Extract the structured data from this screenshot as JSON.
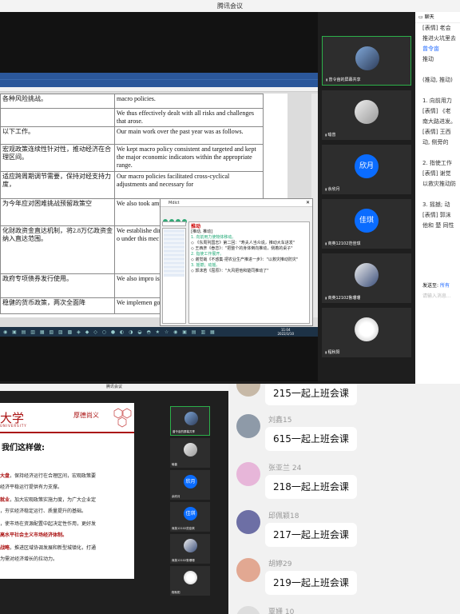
{
  "top_window": {
    "title": "腾讯会议",
    "doc_rows": [
      {
        "zh": "各种风险挑战。",
        "en": "macro policies."
      },
      {
        "zh": "",
        "en": "We thus effectively dealt with all risks and challenges that arose."
      },
      {
        "zh": "以下工作。",
        "en": "Our main work over the past year was as follows."
      },
      {
        "zh": "宏观政策连续性针对性，推动经济在合理区间。",
        "en": "We kept macro policy consistent and targeted and kept the major economic indicators within the appropriate range."
      },
      {
        "zh": "适应跨周期调节需要，保持对经支持力度，",
        "en": "Our macro policies facilitated cross-cyclical adjustments and necessary for"
      },
      {
        "zh": "为今年应对困难挑战预留政策空",
        "en": "We also took ample policy challenges thi"
      },
      {
        "zh": "化财政资金直达机制，将2.8万亿政资金纳入直达范围。",
        "en": "We establishe directly alloca and county-le trillion yuan o under this mec"
      },
      {
        "zh": "政府专项债券发行使用。",
        "en": "We also impro issue and use"
      },
      {
        "zh": "稳健的货币政策，两次全面降",
        "en": "We implemen good effect an"
      }
    ],
    "taskbar_time": "11:04",
    "taskbar_date": "2022/3/10",
    "popup": {
      "title": "Mdict",
      "entry": "推动",
      "lines": [
        "[推动, 推动]",
        "1. 向前用力使物体移动。",
        "◇ 《东周列国志》第二回：\"寿夫人当众说，推动大车进发\"",
        "◇ 王西彦《眷恋》：\"把整个的身体倒向推动，侧着的桌子\"",
        "2. 指使工作展开。",
        "◇ 谢觉哉《不惑集·把农业生产推进一步》：\"以救灾推动防灾\"",
        "3. 摇撼；动摇。",
        "◇ 郭沫若《屈原》：\"大风把他和楚同推动了\""
      ]
    },
    "video_tiles": [
      {
        "name": "曾令亩的屏幕共享",
        "avatar": "photo",
        "active": true
      },
      {
        "name": "喻曾",
        "avatar": "photo",
        "active": false
      },
      {
        "name": "余欣月",
        "avatar_text": "欣月",
        "active": false
      },
      {
        "name": "商英12102范佳琪",
        "avatar_text": "佳琪",
        "active": false
      },
      {
        "name": "商英12102鲁珊珊",
        "avatar": "photo",
        "active": false
      },
      {
        "name": "程秋阳",
        "avatar": "photo",
        "active": false
      }
    ],
    "chat": {
      "header": "聊天",
      "lines": [
        {
          "text": "[表情] 老会",
          "style": ""
        },
        {
          "text": "推进火坑里去",
          "style": ""
        },
        {
          "text": "曾令亩",
          "style": "blue"
        },
        {
          "text": "推动",
          "style": ""
        },
        {
          "text": "",
          "style": ""
        },
        {
          "text": "(推动, 推动)",
          "style": ""
        },
        {
          "text": "",
          "style": ""
        },
        {
          "text": "1. 向前用力",
          "style": ""
        },
        {
          "text": "[表情] 《老",
          "style": ""
        },
        {
          "text": "南大路进发。",
          "style": ""
        },
        {
          "text": "[表情] 王西",
          "style": ""
        },
        {
          "text": "动, 侧旁的",
          "style": ""
        },
        {
          "text": "",
          "style": ""
        },
        {
          "text": "2. 指使工作",
          "style": ""
        },
        {
          "text": "[表情] 谢觉",
          "style": ""
        },
        {
          "text": "以救灾推动防",
          "style": ""
        },
        {
          "text": "",
          "style": ""
        },
        {
          "text": "3. 摇撼; 动",
          "style": ""
        },
        {
          "text": "[表情] 郭沫",
          "style": ""
        },
        {
          "text": "他和 楚 同性",
          "style": ""
        }
      ],
      "send_to_label": "发送至:",
      "send_to_value": "所有",
      "input_placeholder": "请输入消息..."
    }
  },
  "bottom_window": {
    "title": "腾讯会议",
    "slide": {
      "logo": "大学",
      "logo_sub": "UNIVERSITY",
      "motto": "厚德尚义",
      "heading": "我们这样做:",
      "lines": [
        {
          "bold": "大盘",
          "rest": "，保持经济运行在合理区间，宏观政策要"
        },
        {
          "bold": "",
          "rest": "经济平稳运行提供有力支撑。"
        },
        {
          "bold": "就业",
          "rest": "，加大宏观政策实施力度，为广大企业定"
        },
        {
          "bold": "",
          "rest": "，夯实经济稳定运行、质量提升的基础。"
        },
        {
          "bold": "",
          "rest": "，使市场在资源配置中起决定性作用，更好发"
        },
        {
          "bold": "高水平社会主义市场经济体制。",
          "rest": ""
        },
        {
          "bold": "战略",
          "rest": "，推进区域协调发展和新型城镇化，打通"
        },
        {
          "bold": "",
          "rest": "为需对经济增长的拉动力。"
        }
      ]
    },
    "video_tiles": [
      {
        "name": "曾令亩的屏幕共享",
        "avatar": "photo",
        "active": true
      },
      {
        "name": "喻曾",
        "avatar": "photo",
        "active": false
      },
      {
        "name": "余欣月",
        "avatar_text": "欣月",
        "active": false
      },
      {
        "name": "商英12102范佳琪",
        "avatar_text": "佳琪",
        "active": false
      },
      {
        "name": "商英12102鲁珊珊",
        "avatar": "photo",
        "active": false
      },
      {
        "name": "程秋阳",
        "avatar": "photo",
        "active": false
      }
    ]
  },
  "chat_screenshot": {
    "messages": [
      {
        "name": "",
        "text": "215一起上班会课",
        "avatar_color": "#c7b9a7"
      },
      {
        "name": "刘鑫15",
        "text": "615一起上班会课",
        "avatar_color": "#8e9aa8"
      },
      {
        "name": "张亚兰 24",
        "text": "218一起上班会课",
        "avatar_color": "#e7b6d9"
      },
      {
        "name": "邱佩颖18",
        "text": "217一起上班会课",
        "avatar_color": "#6d6fa5"
      },
      {
        "name": "胡婷29",
        "text": "219一起上班会课",
        "avatar_color": "#e2a892"
      },
      {
        "name": "覃姗 10",
        "text": "",
        "avatar_color": "#dddddd"
      }
    ]
  },
  "colors": {
    "accent_green": "#2cb14a",
    "avatar_blue": "#0a6cff",
    "word_blue": "#2b579a",
    "slide_red": "#aa1111",
    "link_blue": "#1a66ff"
  }
}
